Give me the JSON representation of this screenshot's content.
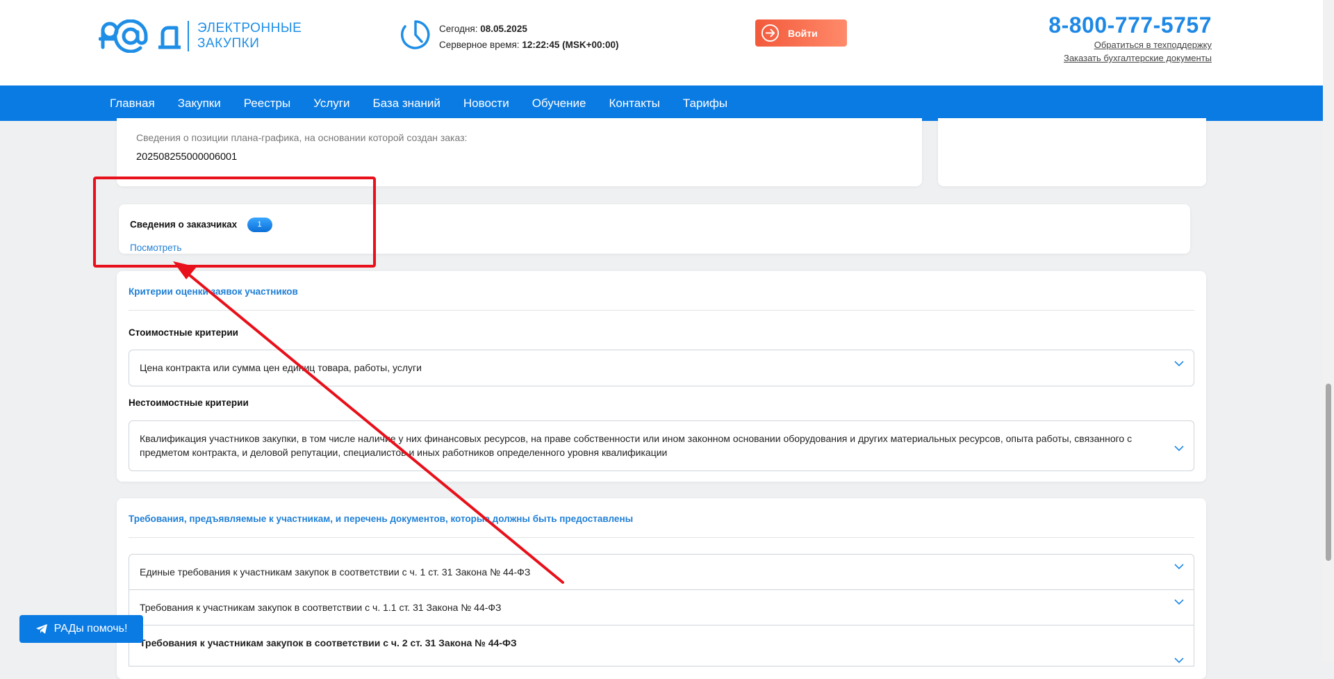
{
  "header": {
    "logo_text_line1": "ЭЛЕКТРОННЫЕ",
    "logo_text_line2": "ЗАКУПКИ",
    "today_label": "Сегодня:",
    "today_value": "08.05.2025",
    "server_time_label": "Серверное время:",
    "server_time_value": "12:22:45 (MSK+00:00)",
    "login_label": "Войти",
    "phone": "8-800-777-5757",
    "support_link": "Обратиться в техподдержку",
    "docs_link": "Заказать бухгалтерские документы"
  },
  "nav": {
    "items": [
      "Главная",
      "Закупки",
      "Реестры",
      "Услуги",
      "База знаний",
      "Новости",
      "Обучение",
      "Контакты",
      "Тарифы"
    ]
  },
  "plan_card": {
    "label": "Сведения о позиции плана-графика, на основании которой создан заказ:",
    "value": "202508255000006001"
  },
  "customers_card": {
    "title": "Сведения о заказчиках",
    "count": "1",
    "view_link": "Посмотреть"
  },
  "criteria": {
    "title": "Критерии оценки заявок участников",
    "cost_heading": "Стоимостные критерии",
    "cost_item": "Цена контракта или сумма цен единиц товара, работы, услуги",
    "noncost_heading": "Нестоимостные критерии",
    "noncost_item": "Квалификация участников закупки, в том числе наличие у них финансовых ресурсов, на праве собственности или ином законном основании оборудования и других материальных ресурсов, опыта работы, связанного с предметом контракта, и деловой репутации, специалистов и иных работников определенного уровня квалификации"
  },
  "requirements": {
    "title": "Требования, предъявляемые к участникам, и перечень документов, которые должны быть предоставлены",
    "items": [
      "Единые требования к участникам закупок в соответствии с ч. 1 ст. 31 Закона № 44-ФЗ",
      "Требования к участникам закупок в соответствии с ч. 1.1 ст. 31 Закона № 44-ФЗ",
      "Требования к участникам закупок в соответствии с ч. 2 ст. 31 Закона № 44-ФЗ"
    ]
  },
  "help": {
    "label": "РАДы помочь!"
  },
  "colors": {
    "brand": "#0a7be3",
    "accent": "#1e88e5",
    "login": "#f25a3b",
    "annotation": "#e8101a"
  },
  "icons": [
    "logo-mark",
    "clock-icon",
    "arrow-right-circle-icon",
    "chevron-down-icon",
    "telegram-icon"
  ]
}
